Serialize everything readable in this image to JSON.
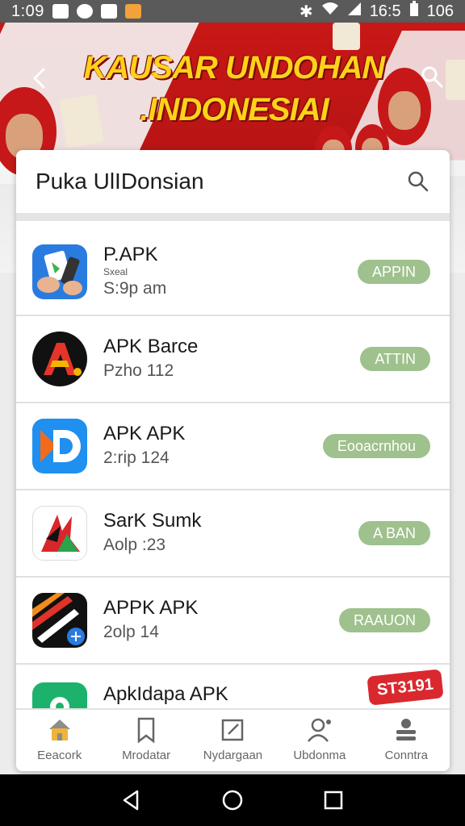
{
  "status_bar": {
    "time": "1:09",
    "right_text": "16:5",
    "battery": "106"
  },
  "banner": {
    "title_line1": "KAUSAR UNDOHAN",
    "title_line2": ".INDONESIAI"
  },
  "card": {
    "title": "Puka UlIDonsian"
  },
  "apps": [
    {
      "name": "P.APK",
      "sub": "Sxeal",
      "meta": "S:9p am",
      "action": "APPIN",
      "icon": "app-icon-blue-hands"
    },
    {
      "name": "APK Barce",
      "sub": "",
      "meta": "Pzho 112",
      "action": "ATTIN",
      "icon": "app-icon-black-a"
    },
    {
      "name": "APK APK",
      "sub": "",
      "meta": "2:rip 124",
      "action": "Eooacrnhou",
      "icon": "app-icon-blue-d"
    },
    {
      "name": "SarK Sumk",
      "sub": "",
      "meta": "Aolp :23",
      "action": "A BAN",
      "icon": "app-icon-flame"
    },
    {
      "name": "APPK APK",
      "sub": "",
      "meta": "2olp 14",
      "action": "RAAUON",
      "icon": "app-icon-stripes"
    },
    {
      "name": "ApkIdapa APK",
      "sub": "",
      "meta": "",
      "action": "",
      "icon": "app-icon-green"
    }
  ],
  "promo_badge": "ST3191",
  "bottom_nav": [
    {
      "label": "Eeacork",
      "icon": "home-icon"
    },
    {
      "label": "Mrodatar",
      "icon": "bookmark-icon"
    },
    {
      "label": "Nydargaan",
      "icon": "edit-icon"
    },
    {
      "label": "Ubdonma",
      "icon": "user-icon"
    },
    {
      "label": "Conntra",
      "icon": "layers-icon"
    }
  ],
  "colors": {
    "accent_red": "#c81717",
    "pill_green": "#9fc18d",
    "banner_title": "#ffd21a"
  }
}
